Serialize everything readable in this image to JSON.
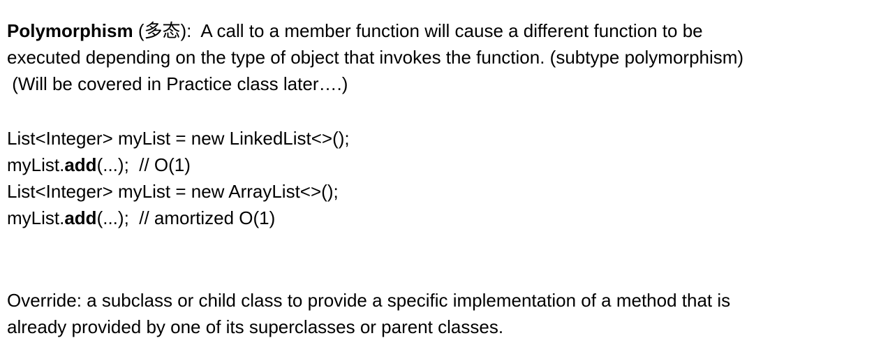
{
  "polymorphism": {
    "term": "Polymorphism",
    "chinese": " (多态):  A call to a member function will cause a different function to be",
    "line2": "executed depending on the type of object that invokes the function. (subtype polymorphism)",
    "line3": " (Will be covered in Practice class later….)"
  },
  "code": {
    "line1": "List<Integer> myList = new LinkedList<>();",
    "line2_prefix": "myList.",
    "line2_method": "add",
    "line2_suffix": "(...);  // O(1)",
    "line3": "List<Integer> myList = new ArrayList<>();",
    "line4_prefix": "myList.",
    "line4_method": "add",
    "line4_suffix": "(...);  // amortized O(1)"
  },
  "override": {
    "line1": "Override: a subclass or child class to provide a specific implementation of a method that is",
    "line2": "already provided by one of its superclasses or parent classes."
  }
}
